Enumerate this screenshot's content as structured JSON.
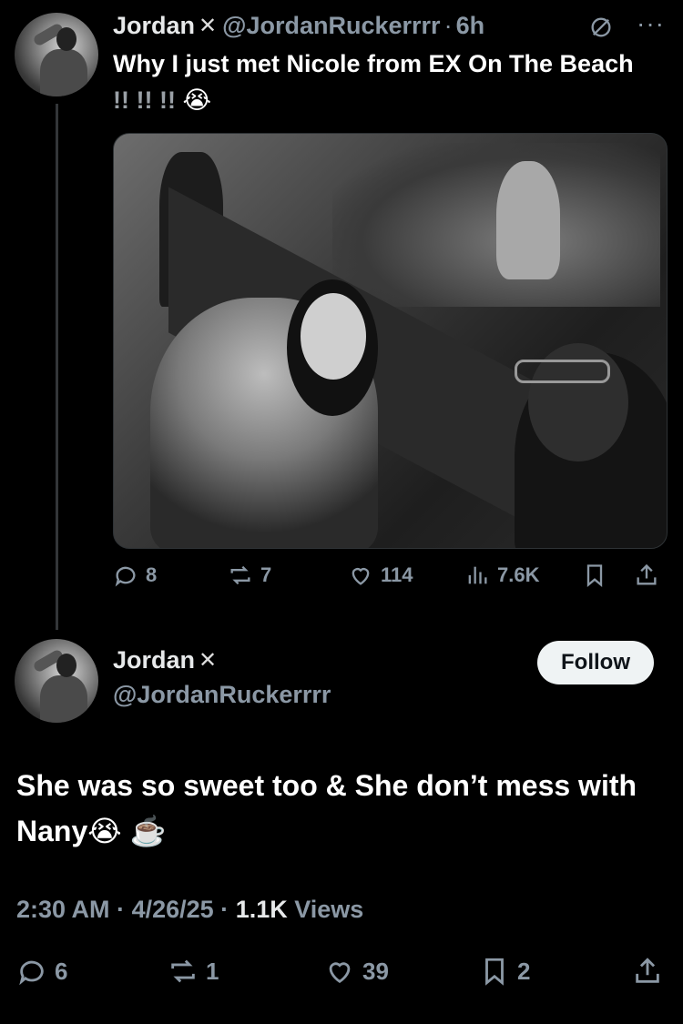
{
  "tweet1": {
    "author_name": "Jordan",
    "flag_icon": "flag-icon",
    "handle": "@JordanRuckerrrr",
    "separator": "·",
    "time": "6h",
    "text_main": "Why I just met Nicole from EX On The Beach",
    "text_bangs": "!! !! !!",
    "text_emoji": "😭",
    "stats": {
      "replies": "8",
      "reposts": "7",
      "likes": "114",
      "views": "7.6K"
    }
  },
  "tweet2": {
    "author_name": "Jordan",
    "flag_icon": "flag-icon",
    "handle": "@JordanRuckerrrr",
    "follow_label": "Follow",
    "text": "She was so sweet too & She don’t mess with Nany😭 ☕️",
    "time": "2:30 AM",
    "date": "4/26/25",
    "separator": "·",
    "views_count": "1.1K",
    "views_label": "Views",
    "stats": {
      "replies": "6",
      "reposts": "1",
      "likes": "39",
      "bookmarks": "2"
    }
  },
  "colors": {
    "background": "#000000",
    "text_primary": "#e7e9ea",
    "text_secondary": "#8b98a5",
    "follow_bg": "#eff3f4"
  }
}
